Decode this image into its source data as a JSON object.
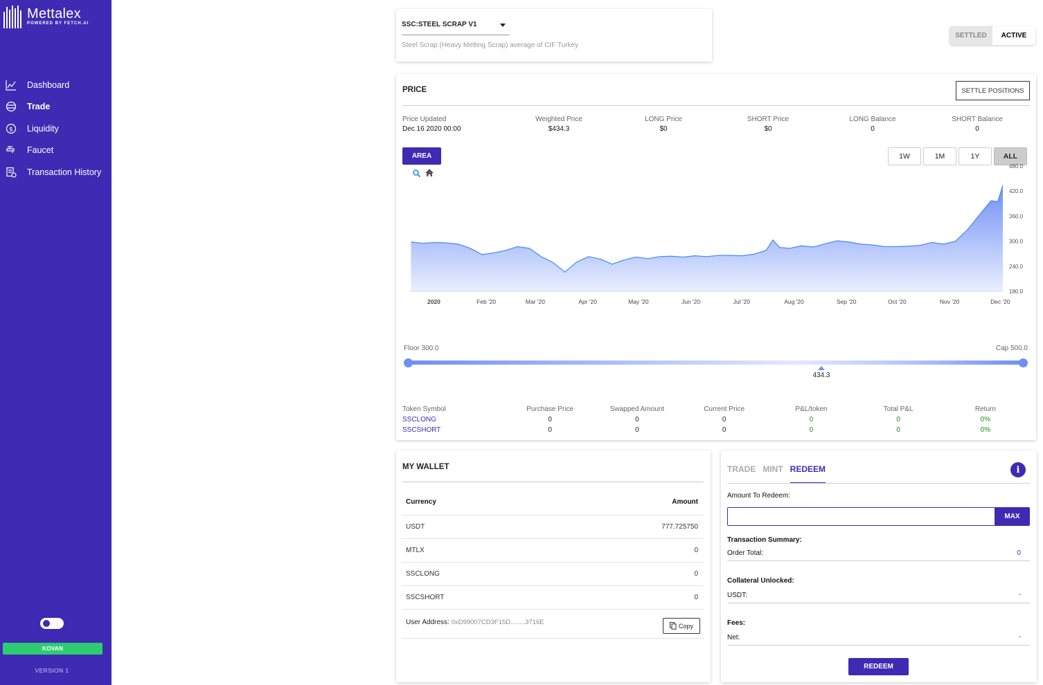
{
  "brand": {
    "name": "Mettalex",
    "sub": "POWERED BY FETCH.AI"
  },
  "nav": [
    {
      "label": "Dashboard",
      "icon": "chart-line-icon"
    },
    {
      "label": "Trade",
      "icon": "trade-icon"
    },
    {
      "label": "Liquidity",
      "icon": "dollar-circle-icon"
    },
    {
      "label": "Faucet",
      "icon": "faucet-icon"
    },
    {
      "label": "Transaction History",
      "icon": "history-icon"
    }
  ],
  "sidebar_footer": {
    "network": "KOVAN",
    "version": "VERSION 1"
  },
  "market": {
    "selected": "SSC:STEEL SCRAP V1",
    "description": "Steel Scrap (Heavy Melting Scrap) average of CIF Turkey"
  },
  "status_toggle": {
    "settled": "SETTLED",
    "active": "ACTIVE"
  },
  "price": {
    "title": "PRICE",
    "settle_btn": "SETTLE POSITIONS",
    "stats": [
      {
        "label": "Price Updated",
        "value": "Dec 16 2020 00:00"
      },
      {
        "label": "Weighted Price",
        "value": "$434.3"
      },
      {
        "label": "LONG Price",
        "value": "$0"
      },
      {
        "label": "SHORT Price",
        "value": "$0"
      },
      {
        "label": "LONG Balance",
        "value": "0"
      },
      {
        "label": "SHORT Balance",
        "value": "0"
      }
    ],
    "chart_type_btn": "AREA",
    "ranges": [
      "1W",
      "1M",
      "1Y",
      "ALL"
    ],
    "selected_range": "ALL"
  },
  "chart_data": {
    "type": "area",
    "x": [
      "2020-01-01",
      "2020-01-08",
      "2020-01-15",
      "2020-01-22",
      "2020-01-29",
      "2020-02-05",
      "2020-02-12",
      "2020-02-19",
      "2020-02-26",
      "2020-03-04",
      "2020-03-11",
      "2020-03-18",
      "2020-03-25",
      "2020-04-01",
      "2020-04-08",
      "2020-04-15",
      "2020-04-22",
      "2020-04-29",
      "2020-05-06",
      "2020-05-13",
      "2020-05-20",
      "2020-05-27",
      "2020-06-03",
      "2020-06-10",
      "2020-06-17",
      "2020-06-24",
      "2020-07-01",
      "2020-07-08",
      "2020-07-15",
      "2020-07-22",
      "2020-07-29",
      "2020-08-02",
      "2020-08-06",
      "2020-08-12",
      "2020-08-19",
      "2020-08-26",
      "2020-09-02",
      "2020-09-09",
      "2020-09-16",
      "2020-09-23",
      "2020-09-30",
      "2020-10-07",
      "2020-10-14",
      "2020-10-21",
      "2020-10-28",
      "2020-11-04",
      "2020-11-11",
      "2020-11-18",
      "2020-11-25",
      "2020-12-02",
      "2020-12-09",
      "2020-12-13",
      "2020-12-16"
    ],
    "y": [
      298,
      295,
      297,
      296,
      293,
      283,
      268,
      272,
      278,
      287,
      283,
      263,
      249,
      226,
      250,
      263,
      257,
      245,
      255,
      262,
      258,
      263,
      264,
      262,
      265,
      263,
      266,
      266,
      265,
      269,
      278,
      303,
      285,
      283,
      289,
      286,
      294,
      301,
      298,
      293,
      291,
      287,
      287,
      288,
      290,
      297,
      293,
      300,
      327,
      362,
      397,
      395,
      434
    ],
    "ylim": [
      180,
      480
    ],
    "yticks": [
      "480.0",
      "420.0",
      "360.0",
      "300.0",
      "240.0",
      "180.0"
    ],
    "xticks": [
      "2020",
      "Feb '20",
      "Mar '20",
      "Apr '20",
      "May '20",
      "Jun '20",
      "Jul '20",
      "Aug '20",
      "Sep '20",
      "Oct '20",
      "Nov '20",
      "Dec '20"
    ],
    "colors": {
      "line": "#4d8ef5",
      "fill_top": "#6f8ff5",
      "fill_bottom": "#e9efff"
    }
  },
  "slider": {
    "floor_label": "Floor 300.0",
    "cap_label": "Cap 500.0",
    "floor": 300,
    "cap": 500,
    "value": 434.3,
    "value_label": "434.3"
  },
  "tokens": {
    "headers": [
      "Token Symbol",
      "Purchase Price",
      "Swapped Amount",
      "Current Price",
      "P&L/token",
      "Total P&L",
      "Return"
    ],
    "rows": [
      [
        "SSCLONG",
        "0",
        "0",
        "0",
        "0",
        "0",
        "0%"
      ],
      [
        "SSCSHORT",
        "0",
        "0",
        "0",
        "0",
        "0",
        "0%"
      ]
    ]
  },
  "wallet": {
    "title": "MY WALLET",
    "headers": {
      "currency": "Currency",
      "amount": "Amount"
    },
    "rows": [
      {
        "currency": "USDT",
        "amount": "777.725750"
      },
      {
        "currency": "MTLX",
        "amount": "0"
      },
      {
        "currency": "SSCLONG",
        "amount": "0"
      },
      {
        "currency": "SSCSHORT",
        "amount": "0"
      }
    ],
    "address_label": "User Address:",
    "address": "0xD99007CD3F15D........3716E",
    "copy_label": "Copy"
  },
  "redeem": {
    "tabs": [
      "TRADE",
      "MINT",
      "REDEEM"
    ],
    "active_tab": "REDEEM",
    "amount_label": "Amount To Redeem:",
    "amount_value": "",
    "max_label": "MAX",
    "summary_title": "Transaction Summary:",
    "order_total_label": "Order Total:",
    "order_total_value": "0",
    "collateral_title": "Collateral Unlocked:",
    "usdt_label": "USDT:",
    "usdt_value": "-",
    "fees_title": "Fees:",
    "net_label": "Net:",
    "net_value": "-",
    "submit_label": "REDEEM"
  }
}
